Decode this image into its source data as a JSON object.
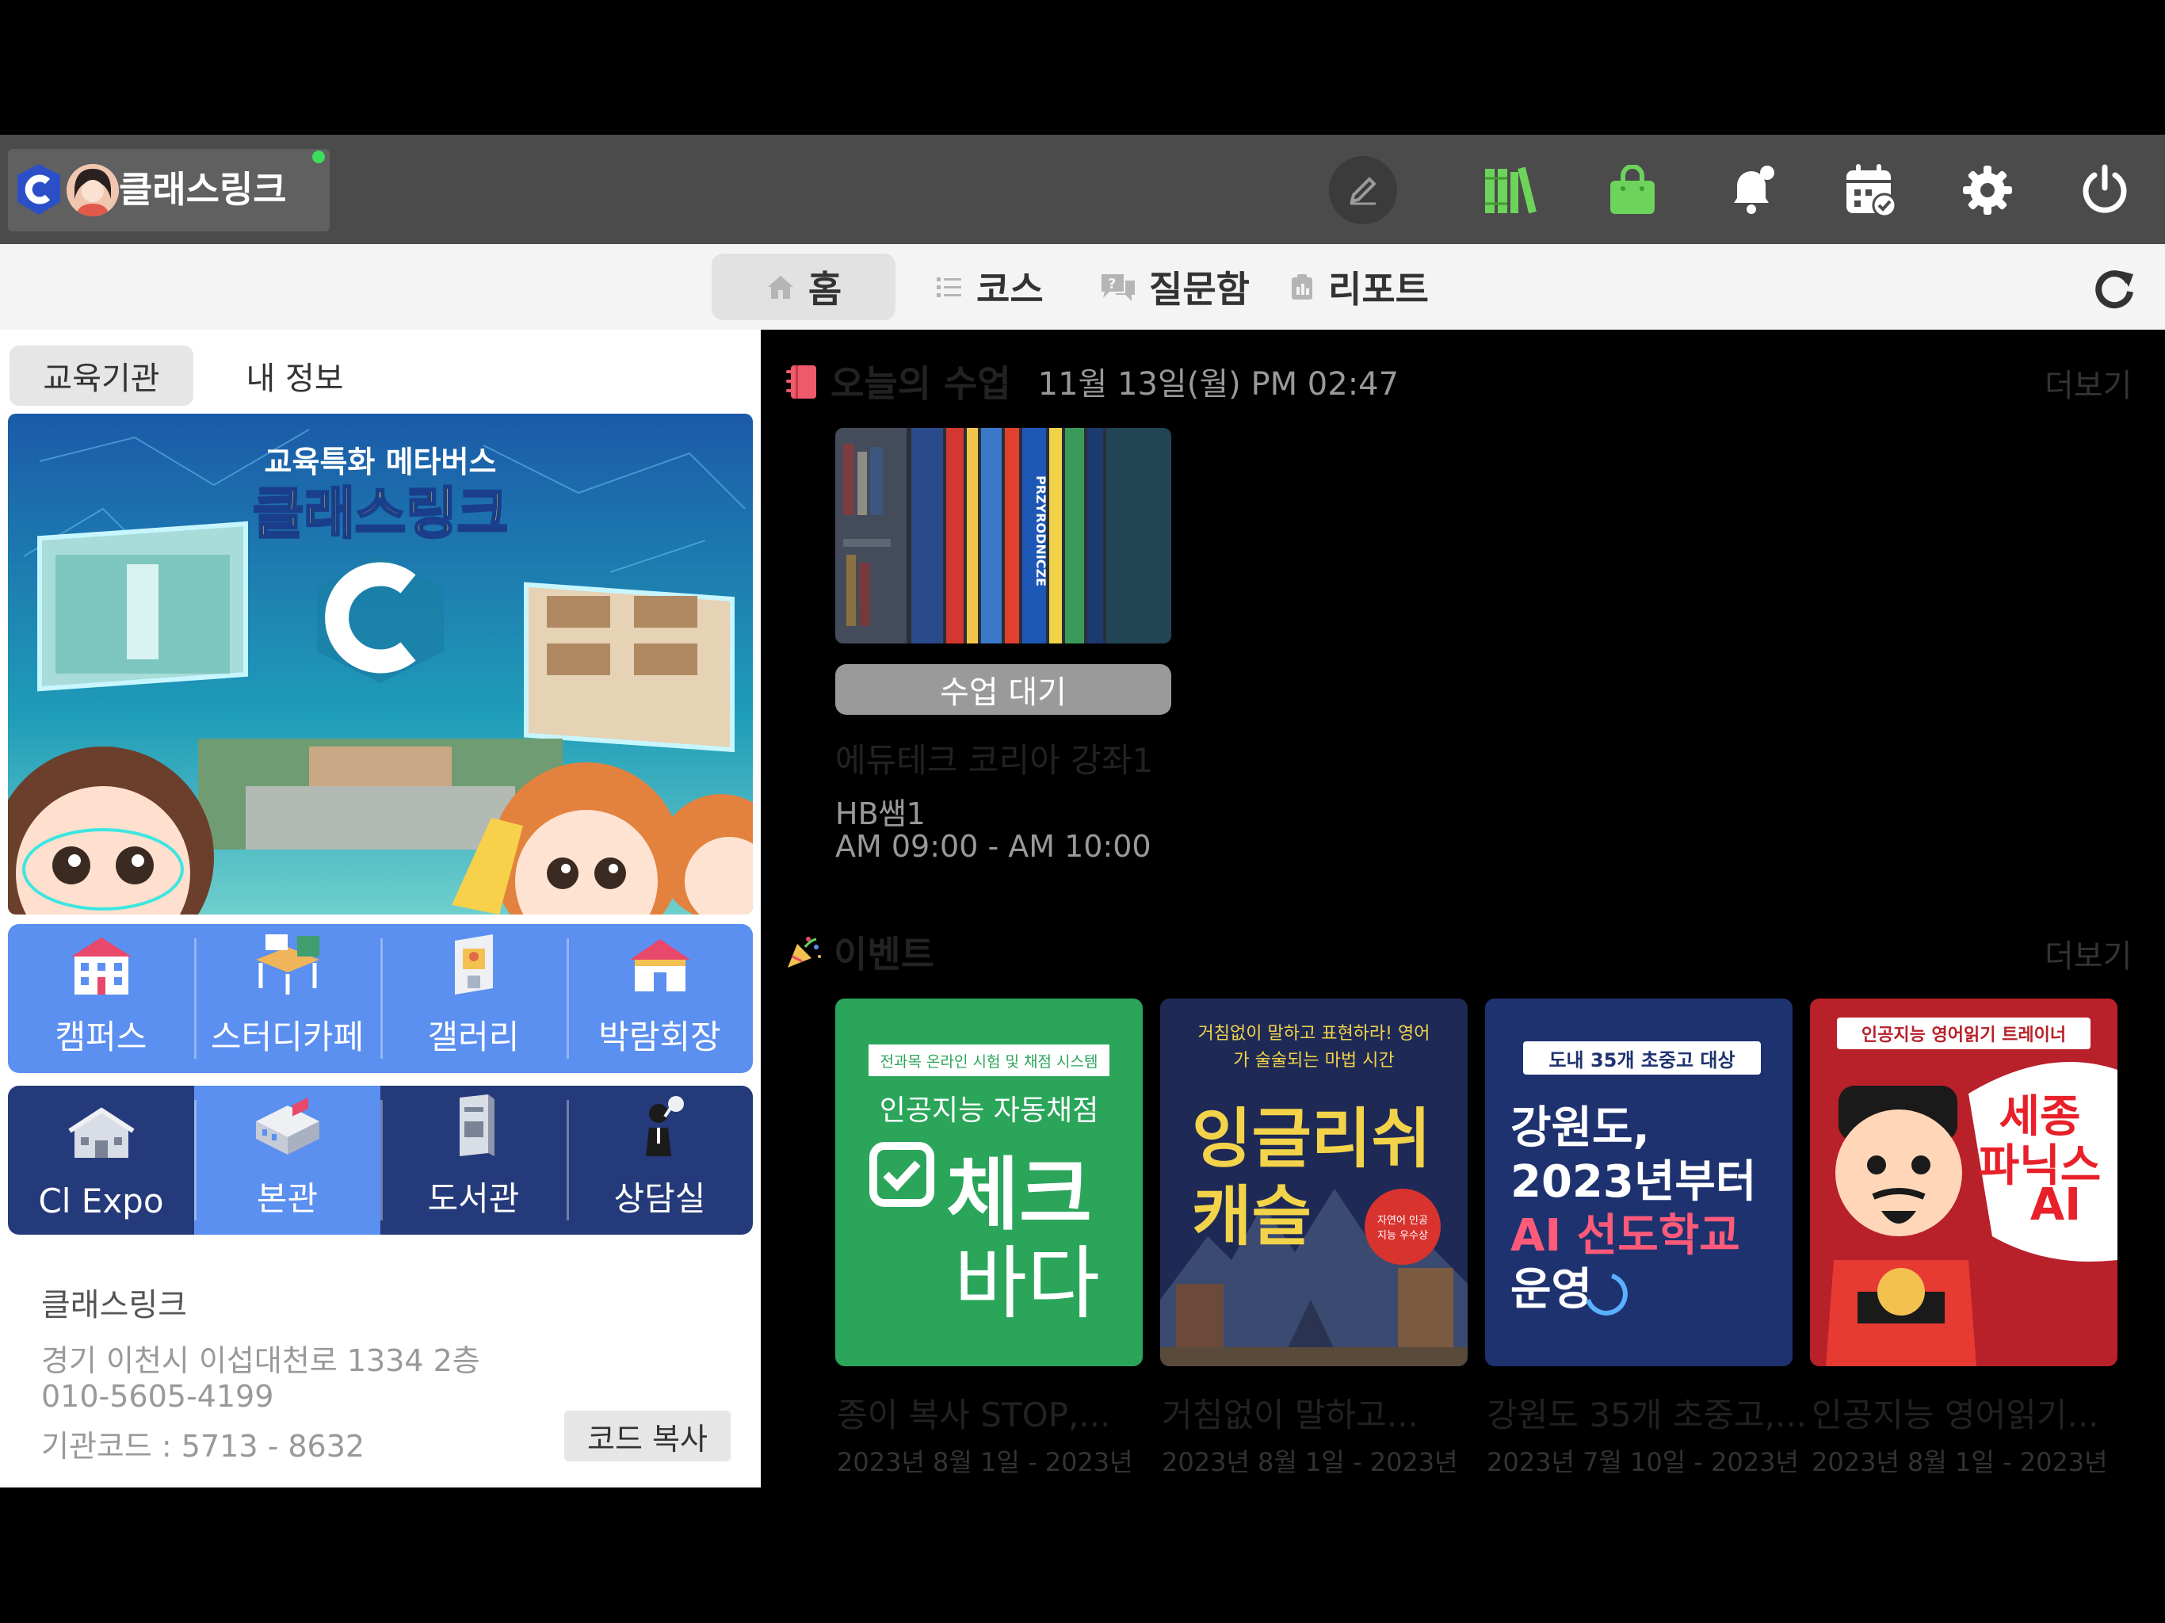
{
  "app": {
    "name": "클래스링크",
    "online": true
  },
  "topbar": {
    "icons": [
      "pencil-icon",
      "books-icon",
      "shopping-bag-icon",
      "bell-icon",
      "calendar-check-icon",
      "gear-icon",
      "power-icon"
    ],
    "colors": {
      "bar": "#4b4b4b",
      "books": "#6cd35b",
      "bag": "#6cd35b"
    }
  },
  "nav": {
    "tabs": [
      {
        "label": "홈",
        "icon": "home-icon",
        "active": true
      },
      {
        "label": "코스",
        "icon": "list-icon",
        "active": false
      },
      {
        "label": "질문함",
        "icon": "question-chat-icon",
        "active": false
      },
      {
        "label": "리포트",
        "icon": "report-icon",
        "active": false
      }
    ]
  },
  "left": {
    "tabs": [
      {
        "label": "교육기관",
        "active": true
      },
      {
        "label": "내 정보",
        "active": false
      }
    ],
    "banner": {
      "subtitle": "교육특화 메타버스",
      "title": "클래스링크"
    },
    "spaces_row1": [
      {
        "label": "캠퍼스",
        "icon": "campus-icon"
      },
      {
        "label": "스터디카페",
        "icon": "study-cafe-icon"
      },
      {
        "label": "갤러리",
        "icon": "gallery-icon"
      },
      {
        "label": "박람회장",
        "icon": "exhibition-icon"
      }
    ],
    "spaces_row2": [
      {
        "label": "Cl Expo",
        "icon": "expo-icon"
      },
      {
        "label": "본관",
        "icon": "main-hall-icon",
        "active": true
      },
      {
        "label": "도서관",
        "icon": "library-icon"
      },
      {
        "label": "상담실",
        "icon": "counseling-icon"
      }
    ],
    "org": {
      "name": "클래스링크",
      "address": "경기 이천시 이섭대천로 1334 2층",
      "phone": "010-5605-4199",
      "code": "기관코드 : 5713 - 8632",
      "copy_label": "코드 복사"
    }
  },
  "today": {
    "title": "오늘의 수업",
    "datetime": "11월 13일(월) PM 02:47",
    "more": "더보기",
    "class": {
      "status": "수업 대기",
      "title": "에듀테크 코리아 강좌1",
      "teacher": "HB쌤1",
      "time": "AM 09:00 - AM 10:00",
      "thumb_text": "PRZYRODNICZE"
    }
  },
  "events": {
    "title": "이벤트",
    "more": "더보기",
    "items": [
      {
        "title": "종이 복사 STOP,...",
        "date": "2023년 8월 1일 - 2023년",
        "poster": {
          "tag": "전과목 온라인 시험 및 채점 시스템",
          "line1": "인공지능 자동채점",
          "line2": "체크",
          "line3": "바다"
        }
      },
      {
        "title": "거침없이 말하고...",
        "date": "2023년 8월 1일 - 2023년",
        "poster": {
          "tag": "거침없이 말하고 표현하라! 영어가 술술되는 마법 시간",
          "line1": "잉글리쉬",
          "line2": "캐슬",
          "badge": "자연어 인공지능 우수상"
        }
      },
      {
        "title": "강원도 35개 초중고,...",
        "date": "2023년 7월 10일 - 2023년",
        "poster": {
          "tag": "도내 35개 초중고 대상",
          "line1": "강원도,",
          "line2": "2023년부터",
          "line3": "AI 선도학교",
          "line4": "운영"
        }
      },
      {
        "title": "인공지능 영어읽기...",
        "date": "2023년 8월 1일 - 2023년",
        "poster": {
          "tag": "인공지능 영어읽기 트레이너",
          "line1": "세종",
          "line2": "파닉스",
          "line3": "AI"
        }
      }
    ]
  }
}
